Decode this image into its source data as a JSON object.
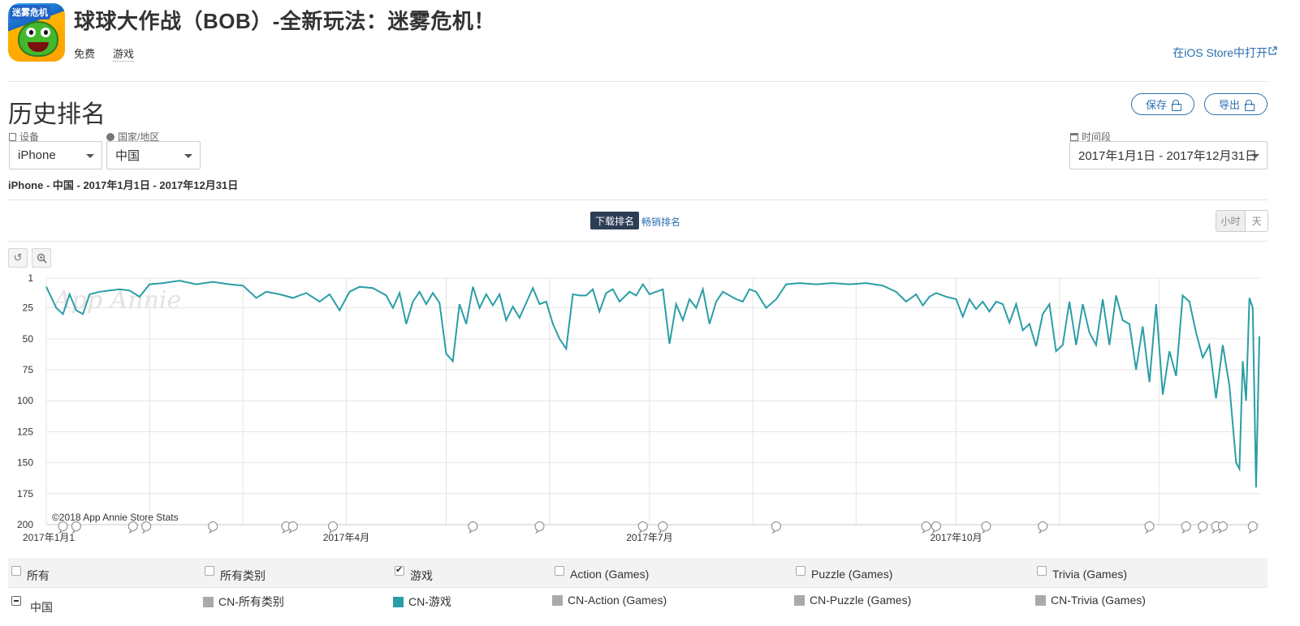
{
  "app": {
    "icon_tag": "迷雾危机",
    "title": "球球大作战（BOB）-全新玩法：迷雾危机！",
    "price": "免费",
    "genre": "游戏",
    "ios_link": "在iOS Store中打开"
  },
  "section": {
    "title": "历史排名",
    "save_label": "保存",
    "export_label": "导出"
  },
  "filters": {
    "device_label": "设备",
    "device_value": "iPhone",
    "country_label": "国家/地区",
    "country_value": "中国",
    "period_label": "时间段",
    "period_value": "2017年1月1日 - 2017年12月31日"
  },
  "summary": "iPhone - 中国 - 2017年1月1日 - 2017年12月31日",
  "tabs": {
    "active": "下载排名",
    "inactive": "畅销排名"
  },
  "granularity": {
    "hour": "小时",
    "day": "天"
  },
  "colors": {
    "series": "#2a9ea6",
    "accent": "#2a6fb0",
    "tab_active_bg": "#2c3e55"
  },
  "chart_data": {
    "type": "line",
    "watermark": "App Annie",
    "credit": "©2018 App Annie Store Stats",
    "y_reversed": true,
    "ylim": [
      1,
      200
    ],
    "y_ticks": [
      1,
      25,
      50,
      75,
      100,
      125,
      150,
      175,
      200
    ],
    "x_range": [
      "2017-01-01",
      "2017-12-31"
    ],
    "x_ticks": [
      "2017年1月1",
      "2017年4月",
      "2017年7月",
      "2017年10月"
    ],
    "x_tick_dates": [
      "2017-01-01",
      "2017-04-01",
      "2017-07-01",
      "2017-10-01"
    ],
    "series": [
      {
        "name": "CN-游戏",
        "points": [
          [
            "2017-01-01",
            8
          ],
          [
            "2017-01-04",
            25
          ],
          [
            "2017-01-06",
            30
          ],
          [
            "2017-01-08",
            14
          ],
          [
            "2017-01-10",
            27
          ],
          [
            "2017-01-12",
            30
          ],
          [
            "2017-01-14",
            14
          ],
          [
            "2017-01-17",
            12
          ],
          [
            "2017-01-20",
            11
          ],
          [
            "2017-01-23",
            10
          ],
          [
            "2017-01-26",
            11
          ],
          [
            "2017-01-29",
            16
          ],
          [
            "2017-02-01",
            6
          ],
          [
            "2017-02-05",
            5
          ],
          [
            "2017-02-10",
            3
          ],
          [
            "2017-02-15",
            6
          ],
          [
            "2017-02-20",
            4
          ],
          [
            "2017-02-25",
            6
          ],
          [
            "2017-03-01",
            7
          ],
          [
            "2017-03-05",
            17
          ],
          [
            "2017-03-08",
            12
          ],
          [
            "2017-03-12",
            14
          ],
          [
            "2017-03-16",
            17
          ],
          [
            "2017-03-20",
            13
          ],
          [
            "2017-03-24",
            20
          ],
          [
            "2017-03-27",
            14
          ],
          [
            "2017-03-30",
            27
          ],
          [
            "2017-04-02",
            12
          ],
          [
            "2017-04-05",
            8
          ],
          [
            "2017-04-09",
            9
          ],
          [
            "2017-04-13",
            15
          ],
          [
            "2017-04-15",
            25
          ],
          [
            "2017-04-17",
            13
          ],
          [
            "2017-04-19",
            38
          ],
          [
            "2017-04-21",
            20
          ],
          [
            "2017-04-23",
            12
          ],
          [
            "2017-04-25",
            22
          ],
          [
            "2017-04-27",
            13
          ],
          [
            "2017-04-29",
            21
          ],
          [
            "2017-05-01",
            62
          ],
          [
            "2017-05-03",
            68
          ],
          [
            "2017-05-05",
            22
          ],
          [
            "2017-05-07",
            38
          ],
          [
            "2017-05-09",
            8
          ],
          [
            "2017-05-11",
            25
          ],
          [
            "2017-05-13",
            14
          ],
          [
            "2017-05-15",
            23
          ],
          [
            "2017-05-17",
            14
          ],
          [
            "2017-05-19",
            35
          ],
          [
            "2017-05-21",
            24
          ],
          [
            "2017-05-23",
            33
          ],
          [
            "2017-05-25",
            21
          ],
          [
            "2017-05-27",
            9
          ],
          [
            "2017-05-29",
            22
          ],
          [
            "2017-05-31",
            20
          ],
          [
            "2017-06-02",
            38
          ],
          [
            "2017-06-04",
            50
          ],
          [
            "2017-06-06",
            58
          ],
          [
            "2017-06-08",
            14
          ],
          [
            "2017-06-10",
            15
          ],
          [
            "2017-06-12",
            15
          ],
          [
            "2017-06-14",
            10
          ],
          [
            "2017-06-16",
            28
          ],
          [
            "2017-06-18",
            13
          ],
          [
            "2017-06-20",
            10
          ],
          [
            "2017-06-22",
            20
          ],
          [
            "2017-06-25",
            12
          ],
          [
            "2017-06-27",
            15
          ],
          [
            "2017-06-29",
            6
          ],
          [
            "2017-07-01",
            14
          ],
          [
            "2017-07-03",
            12
          ],
          [
            "2017-07-05",
            10
          ],
          [
            "2017-07-07",
            54
          ],
          [
            "2017-07-09",
            22
          ],
          [
            "2017-07-11",
            35
          ],
          [
            "2017-07-13",
            18
          ],
          [
            "2017-07-15",
            25
          ],
          [
            "2017-07-17",
            10
          ],
          [
            "2017-07-19",
            38
          ],
          [
            "2017-07-21",
            20
          ],
          [
            "2017-07-23",
            12
          ],
          [
            "2017-07-25",
            15
          ],
          [
            "2017-07-27",
            18
          ],
          [
            "2017-07-29",
            20
          ],
          [
            "2017-07-31",
            10
          ],
          [
            "2017-08-02",
            12
          ],
          [
            "2017-08-05",
            25
          ],
          [
            "2017-08-08",
            18
          ],
          [
            "2017-08-11",
            6
          ],
          [
            "2017-08-15",
            5
          ],
          [
            "2017-08-20",
            6
          ],
          [
            "2017-08-25",
            5
          ],
          [
            "2017-08-30",
            6
          ],
          [
            "2017-09-04",
            5
          ],
          [
            "2017-09-09",
            7
          ],
          [
            "2017-09-13",
            12
          ],
          [
            "2017-09-16",
            20
          ],
          [
            "2017-09-19",
            14
          ],
          [
            "2017-09-21",
            23
          ],
          [
            "2017-09-23",
            16
          ],
          [
            "2017-09-25",
            13
          ],
          [
            "2017-09-28",
            16
          ],
          [
            "2017-10-01",
            18
          ],
          [
            "2017-10-03",
            32
          ],
          [
            "2017-10-05",
            18
          ],
          [
            "2017-10-07",
            26
          ],
          [
            "2017-10-09",
            20
          ],
          [
            "2017-10-11",
            28
          ],
          [
            "2017-10-13",
            20
          ],
          [
            "2017-10-15",
            22
          ],
          [
            "2017-10-17",
            37
          ],
          [
            "2017-10-19",
            22
          ],
          [
            "2017-10-21",
            43
          ],
          [
            "2017-10-23",
            38
          ],
          [
            "2017-10-25",
            56
          ],
          [
            "2017-10-27",
            30
          ],
          [
            "2017-10-29",
            22
          ],
          [
            "2017-10-31",
            60
          ],
          [
            "2017-11-02",
            55
          ],
          [
            "2017-11-04",
            20
          ],
          [
            "2017-11-06",
            55
          ],
          [
            "2017-11-08",
            22
          ],
          [
            "2017-11-10",
            45
          ],
          [
            "2017-11-12",
            55
          ],
          [
            "2017-11-14",
            18
          ],
          [
            "2017-11-16",
            55
          ],
          [
            "2017-11-18",
            15
          ],
          [
            "2017-11-20",
            35
          ],
          [
            "2017-11-22",
            38
          ],
          [
            "2017-11-24",
            75
          ],
          [
            "2017-11-26",
            40
          ],
          [
            "2017-11-28",
            85
          ],
          [
            "2017-11-30",
            22
          ],
          [
            "2017-12-02",
            95
          ],
          [
            "2017-12-04",
            60
          ],
          [
            "2017-12-06",
            80
          ],
          [
            "2017-12-08",
            15
          ],
          [
            "2017-12-10",
            20
          ],
          [
            "2017-12-12",
            45
          ],
          [
            "2017-12-14",
            65
          ],
          [
            "2017-12-16",
            55
          ],
          [
            "2017-12-18",
            98
          ],
          [
            "2017-12-20",
            55
          ],
          [
            "2017-12-22",
            88
          ],
          [
            "2017-12-24",
            150
          ],
          [
            "2017-12-25",
            155
          ],
          [
            "2017-12-26",
            68
          ],
          [
            "2017-12-27",
            100
          ],
          [
            "2017-12-28",
            17
          ],
          [
            "2017-12-29",
            25
          ],
          [
            "2017-12-30",
            170
          ],
          [
            "2017-12-31",
            48
          ]
        ]
      }
    ],
    "annotation_dates": [
      "2017-01-06",
      "2017-01-10",
      "2017-01-27",
      "2017-01-31",
      "2017-02-20",
      "2017-03-14",
      "2017-03-16",
      "2017-03-28",
      "2017-05-09",
      "2017-05-29",
      "2017-06-29",
      "2017-07-05",
      "2017-08-08",
      "2017-09-22",
      "2017-09-25",
      "2017-10-10",
      "2017-10-27",
      "2017-11-28",
      "2017-12-09",
      "2017-12-14",
      "2017-12-18",
      "2017-12-20",
      "2017-12-29"
    ]
  },
  "legend": {
    "row1": [
      {
        "label": "所有",
        "checked": false
      },
      {
        "label": "所有类别",
        "checked": false
      },
      {
        "label": "游戏",
        "checked": true
      },
      {
        "label": "Action (Games)",
        "checked": false
      },
      {
        "label": "Puzzle (Games)",
        "checked": false
      },
      {
        "label": "Trivia (Games)",
        "checked": false
      }
    ],
    "row2_country": "中国",
    "row2": [
      {
        "label": "CN-所有类别",
        "color": "#aaaaaa"
      },
      {
        "label": "CN-游戏",
        "color": "#2a9ea6"
      },
      {
        "label": "CN-Action (Games)",
        "color": "#aaaaaa"
      },
      {
        "label": "CN-Puzzle (Games)",
        "color": "#aaaaaa"
      },
      {
        "label": "CN-Trivia (Games)",
        "color": "#aaaaaa"
      }
    ]
  }
}
